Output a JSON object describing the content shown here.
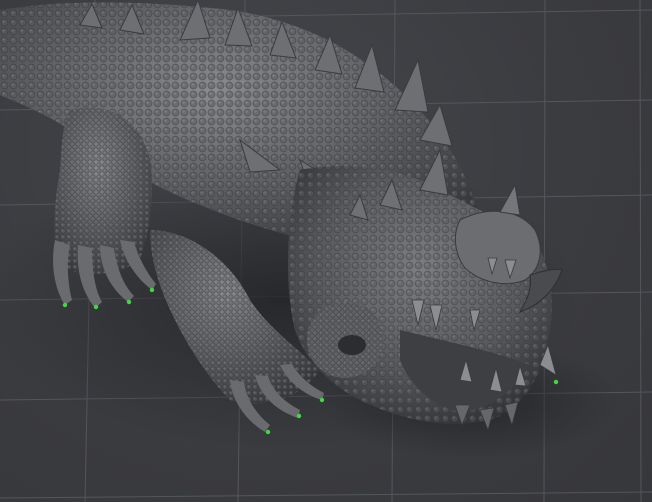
{
  "viewport": {
    "background_color": "#3c3d41",
    "grid": true,
    "grid_color": "#55565c",
    "model_color": "#6b6c70",
    "model_shadow_color": "#2a2b2e",
    "selection_highlight_color": "#3ddc3d",
    "subject": "sculpted-dragon-model"
  }
}
